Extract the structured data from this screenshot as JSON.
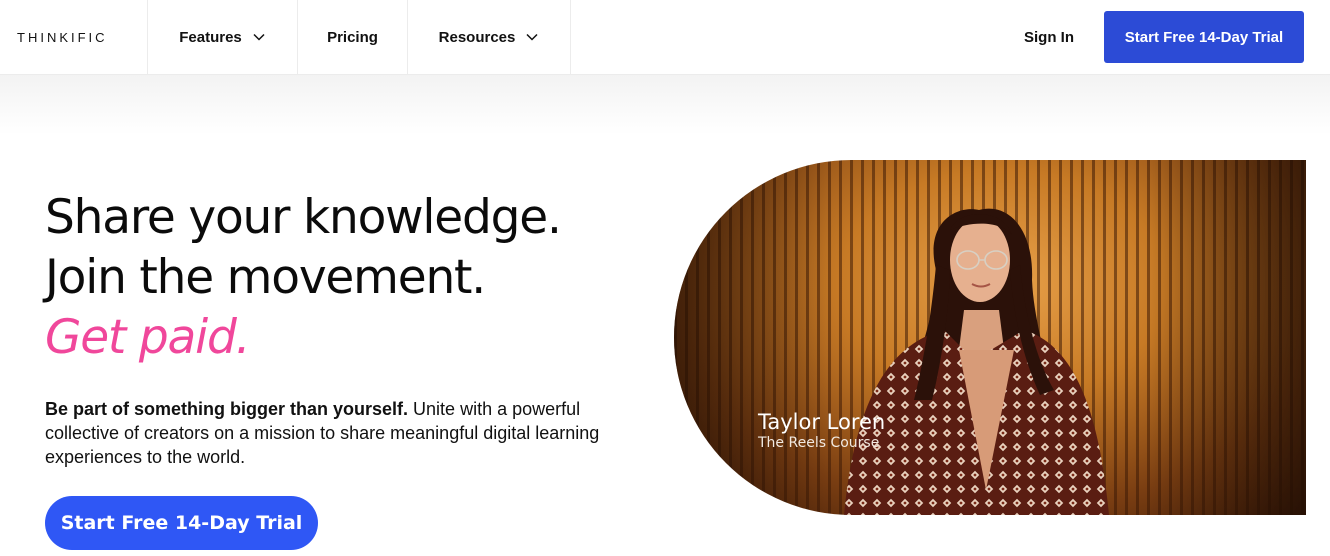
{
  "brand": {
    "logo_text": "THINKIFIC"
  },
  "nav": {
    "items": [
      {
        "label": "Features",
        "has_dropdown": true,
        "icon": "chevron-down-icon"
      },
      {
        "label": "Pricing",
        "has_dropdown": false
      },
      {
        "label": "Resources",
        "has_dropdown": true,
        "icon": "chevron-down-icon"
      }
    ],
    "sign_in": "Sign In",
    "trial_button": "Start Free 14-Day Trial"
  },
  "hero": {
    "headline_line1": "Share your knowledge.",
    "headline_line2": "Join the movement.",
    "headline_accent": "Get paid.",
    "subtext_bold": "Be part of something bigger than yourself.",
    "subtext_rest": " Unite with a powerful collective of creators on a mission to share meaningful digital learning experiences to the world.",
    "cta_label": "Start Free 14-Day Trial",
    "featured_creator": {
      "name": "Taylor Loren",
      "course": "The Reels Course"
    }
  },
  "colors": {
    "nav_button": "#2c4bd6",
    "cta_button": "#2f57f5",
    "accent_pink": "#f0479b"
  }
}
